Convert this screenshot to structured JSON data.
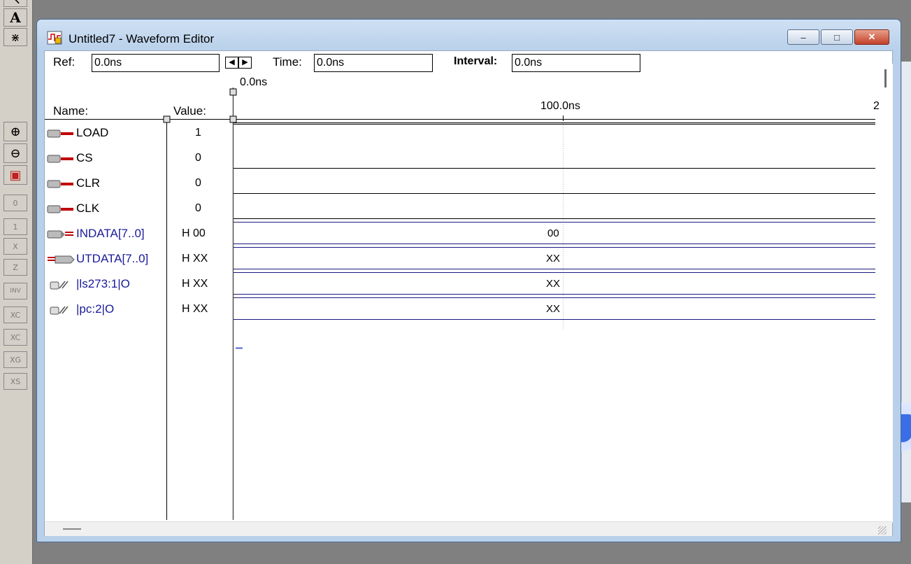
{
  "toolbar": {
    "items": [
      {
        "name": "pointer-tool",
        "glyph": "↖"
      },
      {
        "name": "text-tool",
        "glyph": "A"
      },
      {
        "name": "waveform-edit-tool",
        "glyph": "⋇"
      },
      {
        "name": "zoom-in",
        "glyph": "⊕"
      },
      {
        "name": "zoom-out",
        "glyph": "⊖"
      },
      {
        "name": "fit-in-window",
        "glyph": "▣"
      },
      {
        "name": "set-low-0",
        "glyph": "0"
      },
      {
        "name": "set-high-1",
        "glyph": "1"
      },
      {
        "name": "set-unknown-x",
        "glyph": "X"
      },
      {
        "name": "set-high-z",
        "glyph": "Z"
      },
      {
        "name": "invert",
        "glyph": "INV"
      },
      {
        "name": "overwrite-count",
        "glyph": "XC"
      },
      {
        "name": "overwrite-clock",
        "glyph": "XC"
      },
      {
        "name": "overwrite-group",
        "glyph": "XG"
      },
      {
        "name": "overwrite-sequence",
        "glyph": "XS"
      }
    ]
  },
  "window": {
    "title": "Untitled7 - Waveform Editor",
    "controls": {
      "minimize": "–",
      "maximize": "□",
      "close": "✕"
    }
  },
  "header": {
    "ref_label": "Ref:",
    "ref_value": "0.0ns",
    "time_label": "Time:",
    "time_value": "0.0ns",
    "interval_label": "Interval:",
    "interval_value": "0.0ns",
    "cursor_time": "0.0ns",
    "ruler_tick": "100.0ns",
    "ruler_edge": "2",
    "nav_left": "◀",
    "nav_right": "▶"
  },
  "columns": {
    "name": "Name:",
    "value": "Value:"
  },
  "signals": [
    {
      "name": "LOAD",
      "value": "1",
      "kind": "input",
      "level": "high",
      "bus_label": ""
    },
    {
      "name": "CS",
      "value": "0",
      "kind": "input",
      "level": "low",
      "bus_label": ""
    },
    {
      "name": "CLR",
      "value": "0",
      "kind": "input",
      "level": "low",
      "bus_label": ""
    },
    {
      "name": "CLK",
      "value": "0",
      "kind": "input",
      "level": "low",
      "bus_label": ""
    },
    {
      "name": "INDATA[7..0]",
      "value": "H 00",
      "kind": "input-bus",
      "level": "bus",
      "bus_label": "00"
    },
    {
      "name": "UTDATA[7..0]",
      "value": "H XX",
      "kind": "output-bus",
      "level": "bus",
      "bus_label": "XX"
    },
    {
      "name": "|ls273:1|O",
      "value": "H XX",
      "kind": "buried",
      "level": "bus",
      "bus_label": "XX"
    },
    {
      "name": "|pc:2|O",
      "value": "H XX",
      "kind": "buried",
      "level": "bus",
      "bus_label": "XX"
    }
  ],
  "colors": {
    "input_icon": "#c00000",
    "bus_line": "#1a1a80",
    "group_name": "#1a1a9a"
  }
}
